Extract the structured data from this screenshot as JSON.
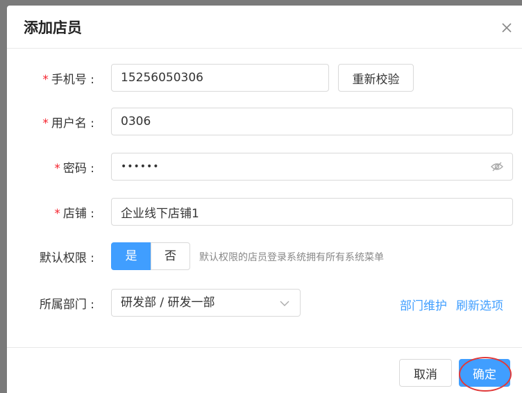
{
  "dialog": {
    "title": "添加店员",
    "close_icon": "close-icon"
  },
  "form": {
    "phone": {
      "label": "手机号 :",
      "value": "15256050306",
      "action_label": "重新校验"
    },
    "username": {
      "label": "用户名 :",
      "value": "0306"
    },
    "password": {
      "label": "密码 :",
      "value": "••••••",
      "icon": "eye-off-icon"
    },
    "store": {
      "label": "店铺 :",
      "value": "企业线下店铺1"
    },
    "default_permission": {
      "label": "默认权限 :",
      "options": [
        "是",
        "否"
      ],
      "selected": "是",
      "hint": "默认权限的店员登录系统拥有所有系统菜单"
    },
    "department": {
      "label": "所属部门 :",
      "value": "研发部 / 研发一部",
      "link_maintain": "部门维护",
      "link_refresh": "刷新选项"
    },
    "required_mark": "*"
  },
  "footer": {
    "cancel_label": "取消",
    "ok_label": "确定"
  },
  "colors": {
    "primary": "#409eff",
    "required": "#f5222d",
    "highlight": "#e03a3a"
  }
}
